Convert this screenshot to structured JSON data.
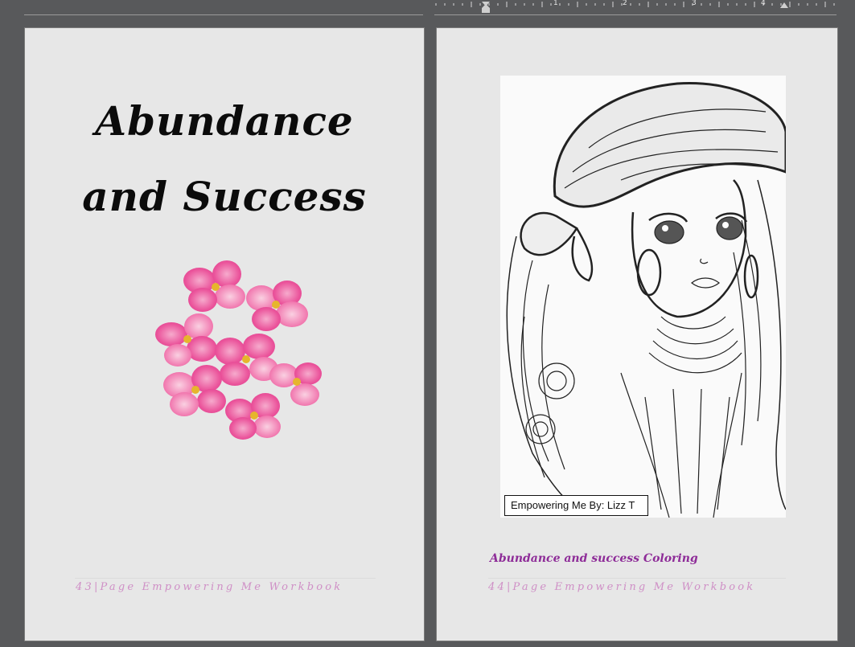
{
  "ruler": {
    "marks": [
      "1",
      "2",
      "3",
      "4"
    ]
  },
  "left_page": {
    "title_line1": "Abundance",
    "title_line2": "and Success",
    "footer": "43|Page Empowering Me Workbook",
    "accent_color": "#e8398c"
  },
  "right_page": {
    "credit": "Empowering Me By: Lizz T",
    "caption": "Abundance and success Coloring",
    "footer": "44|Page Empowering Me Workbook",
    "caption_color": "#8e2c98"
  }
}
